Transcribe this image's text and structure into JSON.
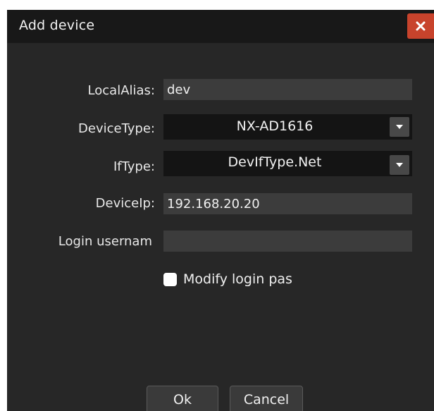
{
  "window": {
    "title": "Add device"
  },
  "icons": {
    "close": "close-icon",
    "dropdown": "chevron-down-icon",
    "checkbox": "checkbox-unchecked"
  },
  "colors": {
    "dialog_bg": "#272727",
    "titlebar_bg": "#181818",
    "close_button": "#c8432c",
    "input_bg": "#3c3c3c",
    "combo_bg": "#141414"
  },
  "form": {
    "local_alias": {
      "label": "LocalAlias:",
      "value": "dev"
    },
    "device_type": {
      "label": "DeviceType:",
      "value": "NX-AD1616"
    },
    "if_type": {
      "label": "IfType:",
      "value": "DevIfType.Net"
    },
    "device_ip": {
      "label": "DeviceIp:",
      "value": "192.168.20.20"
    },
    "login_username": {
      "label": "Login usernam",
      "value": ""
    },
    "modify_login": {
      "label": "Modify login pas",
      "checked": false
    }
  },
  "buttons": {
    "ok": "Ok",
    "cancel": "Cancel"
  }
}
